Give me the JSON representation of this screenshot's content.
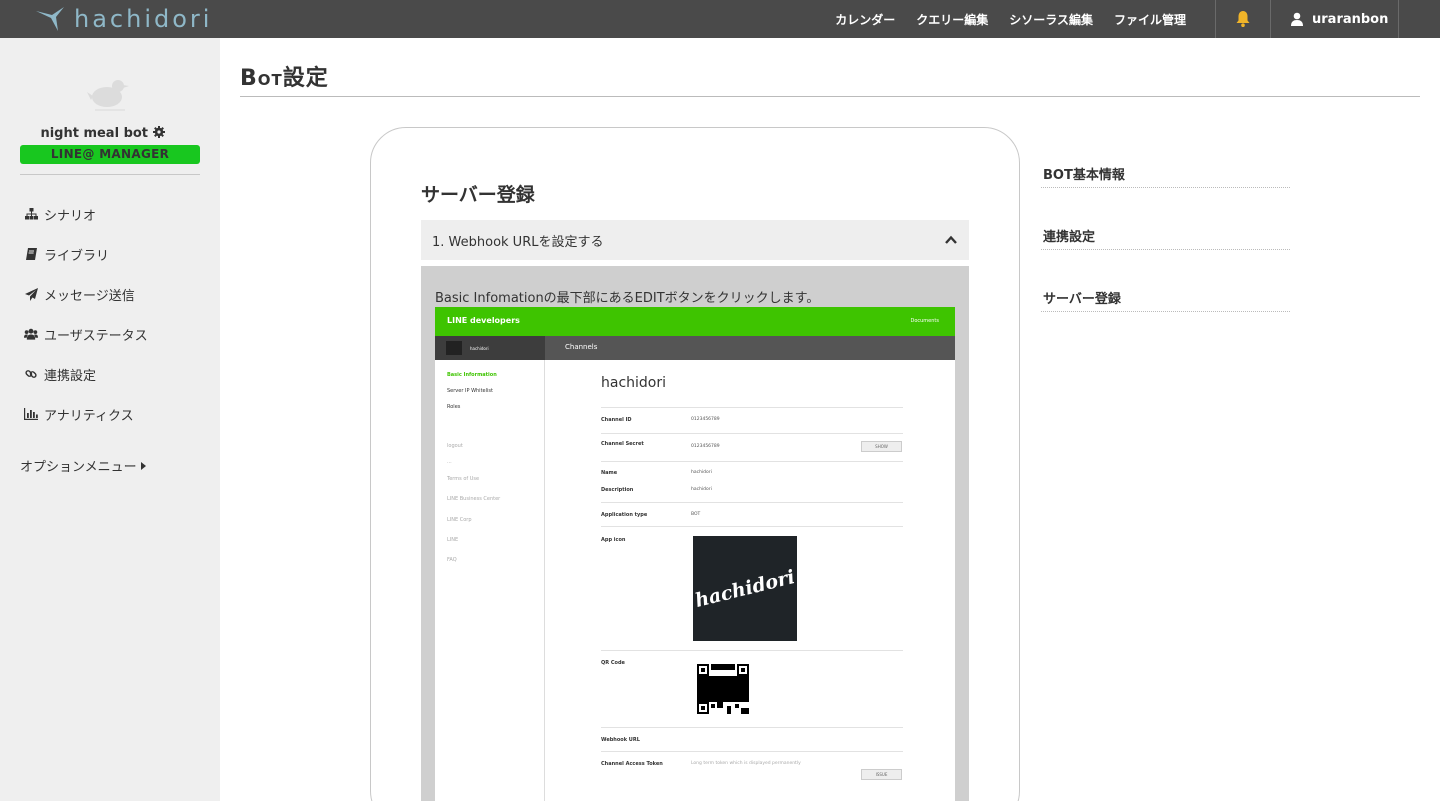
{
  "topbar": {
    "logo_text": "hachidori",
    "nav": [
      "カレンダー",
      "クエリー編集",
      "シソーラス編集",
      "ファイル管理"
    ],
    "user_name": "uraranbon"
  },
  "sidebar": {
    "bot_name": "night meal bot",
    "bot_badge": "LINE@ MANAGER",
    "items": [
      {
        "label": "シナリオ",
        "icon": "sitemap-icon"
      },
      {
        "label": "ライブラリ",
        "icon": "book-icon"
      },
      {
        "label": "メッセージ送信",
        "icon": "paper-plane-icon"
      },
      {
        "label": "ユーザステータス",
        "icon": "users-icon"
      },
      {
        "label": "連携設定",
        "icon": "link-icon"
      },
      {
        "label": "アナリティクス",
        "icon": "bar-chart-icon"
      }
    ],
    "option_menu": "オプションメニュー"
  },
  "page": {
    "title": "Bot設定"
  },
  "card": {
    "title": "サーバー登録",
    "step1_header": "1. Webhook URLを設定する",
    "step1_desc": "Basic Infomationの最下部にあるEDITボタンをクリックします。"
  },
  "embedded_screenshot": {
    "brand": "LINE developers",
    "docs": "Documents",
    "account": "hachidori",
    "channels": "Channels",
    "side_menu": [
      "Basic Information",
      "Server IP Whitelist",
      "Roles"
    ],
    "side_links": [
      "logout",
      "...",
      "Terms of Use",
      "LINE Business Center",
      "LINE Corp",
      "LINE",
      "FAQ"
    ],
    "app_name": "hachidori",
    "fields": {
      "channel_id_label": "Channel ID",
      "channel_id_value": "0123456789",
      "channel_secret_label": "Channel Secret",
      "channel_secret_value": "0123456789",
      "show_button": "SHOW",
      "name_label": "Name",
      "name_value": "hachidori",
      "description_label": "Description",
      "description_value": "hachidori",
      "app_type_label": "Application type",
      "app_type_value": "BOT",
      "app_icon_label": "App icon",
      "app_icon_text": "hachidori",
      "qr_label": "QR Code",
      "webhook_label": "Webhook URL",
      "token_label": "Channel Access Token",
      "token_value": "Long term token which is displayed permanently",
      "issue_button": "ISSUE"
    }
  },
  "index": {
    "items": [
      "BOT基本情報",
      "連携設定",
      "サーバー登録"
    ]
  },
  "colors": {
    "topbar": "#4a4a4a",
    "sidebar": "#efefef",
    "badge_green": "#18c71f",
    "line_green": "#3ec400",
    "bell": "#f0b429"
  }
}
